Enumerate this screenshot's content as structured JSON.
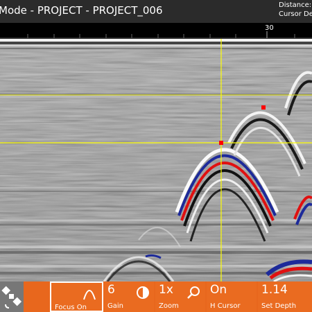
{
  "titlebar": {
    "title": "Mode - PROJECT - PROJECT_006",
    "readout_line1": "Distance:",
    "readout_line2": "Cursor De"
  },
  "scale": {
    "tick_label": "30"
  },
  "toolbar": {
    "gps": {
      "icon": "satellite-icon"
    },
    "focus": {
      "label": "Focus On",
      "icon": "focus-arc-icon"
    },
    "gain": {
      "value": "6",
      "label": "Gain",
      "icon": "contrast-icon"
    },
    "zoom": {
      "value": "1x",
      "label": "Zoom",
      "icon": "magnifier-icon"
    },
    "hcursor": {
      "value": "On",
      "label": "H Cursor"
    },
    "depth": {
      "value": "1.14",
      "label": "Set Depth"
    }
  },
  "colors": {
    "accent": "#e8671d",
    "cursor": "#ffff00",
    "marker": "#ff0000"
  }
}
